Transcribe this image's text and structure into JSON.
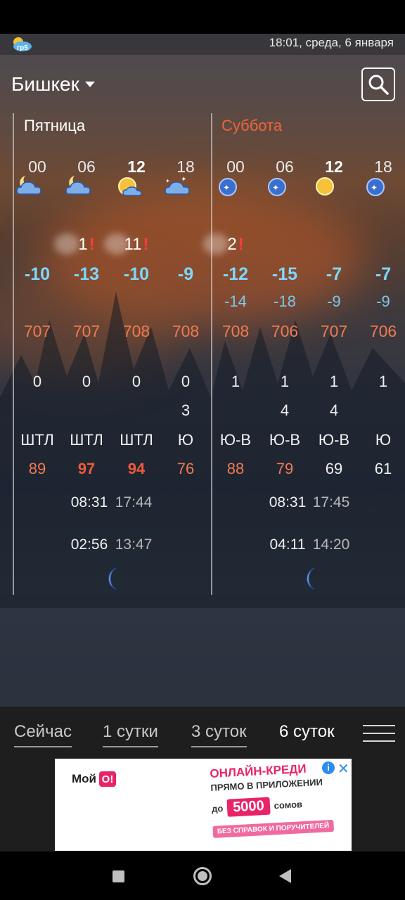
{
  "status_bar": {
    "logo": "gp5-logo",
    "logo_text": "гр5",
    "datetime": "18:01, среда, 6 января"
  },
  "header": {
    "city": "Бишкек",
    "dropdown_icon": "caret-down-icon",
    "search_icon": "search-icon"
  },
  "days": [
    {
      "name": "Пятница",
      "color": "#ffffff",
      "hours": [
        {
          "hour": "00",
          "bold": false,
          "icon": "partly-cloudy-night-icon",
          "precip": "",
          "warn": false,
          "temp": "-10",
          "feels": "",
          "pressure": "707",
          "row_a": "0",
          "row_b": "",
          "wind": "ШТЛ",
          "humidity": "89",
          "humidity_style": "o"
        },
        {
          "hour": "06",
          "bold": false,
          "icon": "partly-cloudy-night-icon",
          "precip": "1",
          "warn": true,
          "temp": "-13",
          "feels": "",
          "pressure": "707",
          "row_a": "0",
          "row_b": "",
          "wind": "ШТЛ",
          "humidity": "97",
          "humidity_style": "b"
        },
        {
          "hour": "12",
          "bold": true,
          "icon": "partly-cloudy-sun-icon",
          "precip": "11",
          "warn": true,
          "temp": "-10",
          "feels": "",
          "pressure": "708",
          "row_a": "0",
          "row_b": "",
          "wind": "ШТЛ",
          "humidity": "94",
          "humidity_style": "b"
        },
        {
          "hour": "18",
          "bold": false,
          "icon": "cloudy-night-stars-icon",
          "precip": "",
          "warn": false,
          "temp": "-9",
          "feels": "",
          "pressure": "708",
          "row_a": "0",
          "row_b": "3",
          "wind": "Ю",
          "humidity": "76",
          "humidity_style": "o"
        }
      ],
      "sunrise": "08:31",
      "sunset": "17:44",
      "moonrise": "02:56",
      "moonset": "13:47",
      "moon_icon": "crescent-moon-icon"
    },
    {
      "name": "Суббота",
      "color": "#f0643c",
      "hours": [
        {
          "hour": "00",
          "bold": false,
          "icon": "clear-night-stars-icon",
          "precip": "2",
          "warn": true,
          "temp": "-12",
          "feels": "-14",
          "pressure": "708",
          "row_a": "1",
          "row_b": "",
          "wind": "Ю-В",
          "humidity": "88",
          "humidity_style": "o"
        },
        {
          "hour": "06",
          "bold": false,
          "icon": "clear-night-stars-icon",
          "precip": "",
          "warn": false,
          "temp": "-15",
          "feels": "-18",
          "pressure": "706",
          "row_a": "1",
          "row_b": "4",
          "wind": "Ю-В",
          "humidity": "79",
          "humidity_style": "o"
        },
        {
          "hour": "12",
          "bold": true,
          "icon": "sun-icon",
          "precip": "",
          "warn": false,
          "temp": "-7",
          "feels": "-9",
          "pressure": "707",
          "row_a": "1",
          "row_b": "4",
          "wind": "Ю-В",
          "humidity": "69",
          "humidity_style": "w"
        },
        {
          "hour": "18",
          "bold": false,
          "icon": "clear-night-stars-icon",
          "precip": "",
          "warn": false,
          "temp": "-7",
          "feels": "-9",
          "pressure": "706",
          "row_a": "1",
          "row_b": "",
          "wind": "Ю",
          "humidity": "61",
          "humidity_style": "w"
        }
      ],
      "sunrise": "08:31",
      "sunset": "17:45",
      "moonrise": "04:11",
      "moonset": "14:20",
      "moon_icon": "crescent-moon-icon"
    }
  ],
  "tabs": [
    {
      "label": "Сейчас",
      "active": false
    },
    {
      "label": "1 сутки",
      "active": false
    },
    {
      "label": "3 суток",
      "active": false
    },
    {
      "label": "6 суток",
      "active": true
    }
  ],
  "menu_icon": "hamburger-menu-icon",
  "ad": {
    "brand": "Мой",
    "brand_badge": "O!",
    "line1": "ОНЛАЙН-КРЕДИ",
    "line2": "ПРЯМО В ПРИЛОЖЕНИИ",
    "prefix": "до",
    "amount": "5000",
    "currency": "сомов",
    "footer": "БЕЗ СПРАВОК И ПОРУЧИТЕЛЕЙ",
    "info_icon": "info-icon",
    "close_icon": "close-icon"
  },
  "nav": {
    "recents": "recents-square-icon",
    "home": "home-circle-icon",
    "back": "back-triangle-icon"
  }
}
